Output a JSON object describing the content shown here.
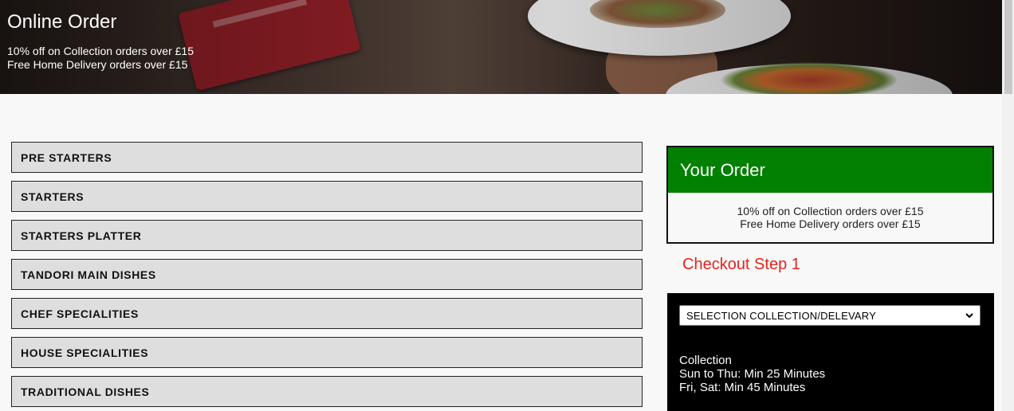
{
  "header": {
    "title": "Online Order",
    "offers": [
      "10% off on Collection orders over £15",
      "Free Home Delivery orders over £15"
    ]
  },
  "menu": {
    "categories": [
      "PRE STARTERS",
      "STARTERS",
      "STARTERS PLATTER",
      "TANDORI MAIN DISHES",
      "CHEF SPECIALITIES",
      "HOUSE SPECIALITIES",
      "TRADITIONAL DISHES"
    ]
  },
  "order": {
    "title": "Your Order",
    "offers": [
      "10% off on Collection orders over £15",
      "Free Home Delivery orders over £15"
    ]
  },
  "checkout": {
    "step_label": "Checkout Step 1",
    "select_value": "SELECTION COLLECTION/DELEVARY",
    "collection_lines": [
      "Collection",
      "Sun to Thu: Min 25 Minutes",
      "Fri, Sat: Min 45 Minutes"
    ]
  },
  "colors": {
    "order_header": "#018001",
    "checkout_step": "#e5231b",
    "category_bg": "#dedede"
  }
}
